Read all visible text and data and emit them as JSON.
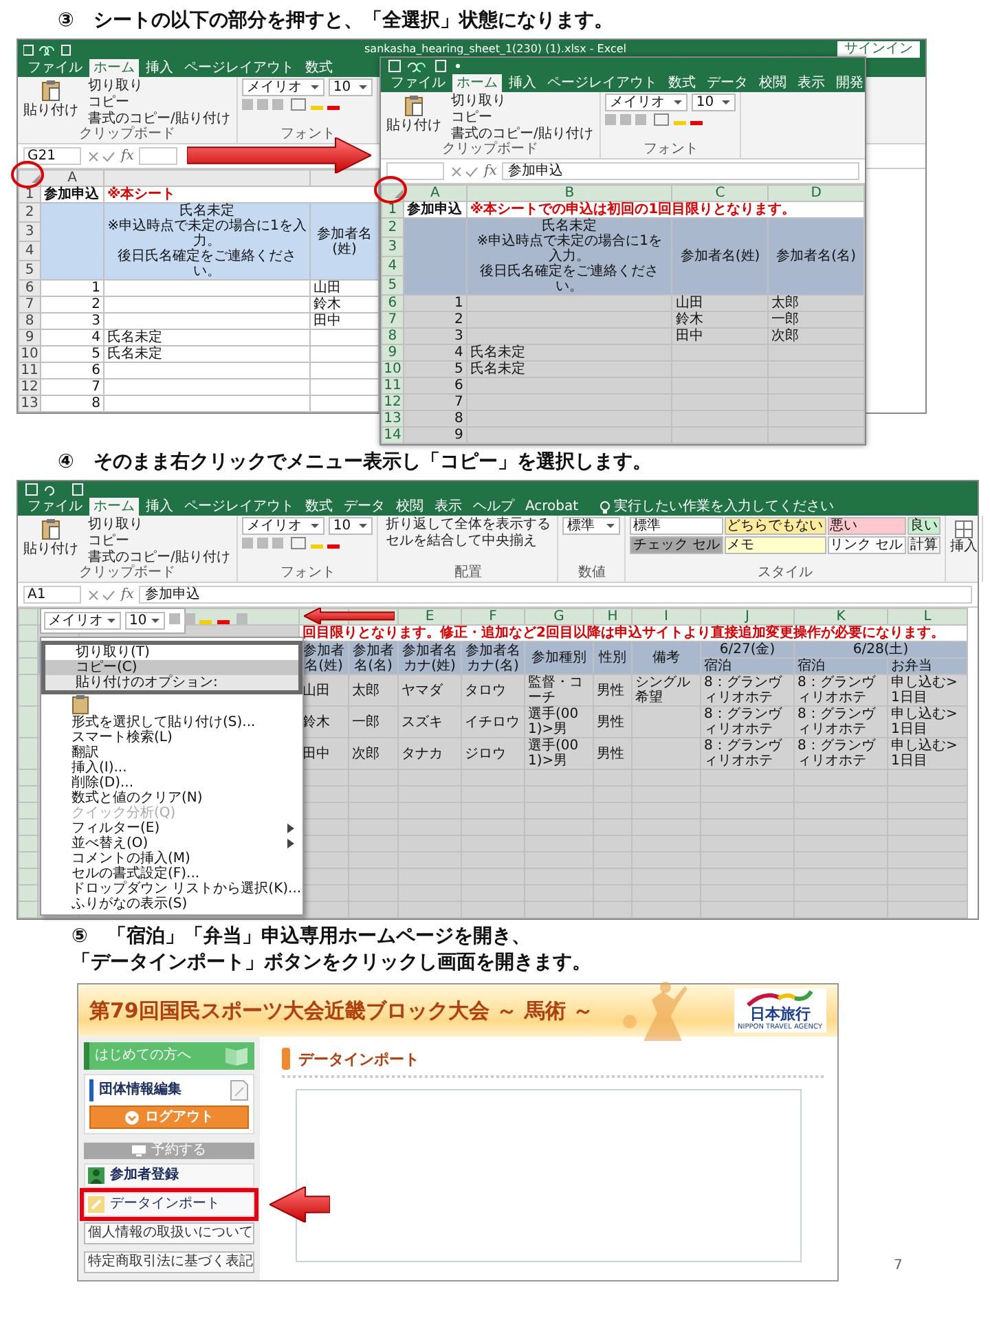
{
  "step3": {
    "heading": "③　シートの以下の部分を押すと、「全選択」状態になります。",
    "back_window": {
      "title": "sankasha_hearing_sheet_1(230) (1).xlsx - Excel",
      "sign_in": "サインイン",
      "tabs": [
        {
          "label": "ファイル",
          "selected": false
        },
        {
          "label": "ホーム",
          "selected": true
        },
        {
          "label": "挿入",
          "selected": false
        },
        {
          "label": "ページレイアウト",
          "selected": false
        },
        {
          "label": "数式",
          "selected": false
        }
      ],
      "ribbon": [
        {
          "kind": "clipboard",
          "paste": "貼り付け",
          "items": [
            "切り取り",
            "コピー",
            "書式のコピー/貼り付け"
          ],
          "label": "クリップボード"
        },
        {
          "kind": "font",
          "font": "メイリオ",
          "size": "10",
          "label": "フォント"
        }
      ],
      "name_box": "G21",
      "fx_label": "fx",
      "sheet": {
        "all_selected": false,
        "corner_circled": true,
        "columns": [
          {
            "letter": "A"
          },
          {
            "heading": [
              "氏名未定",
              "※申込時点で未定の場合に1を入力。",
              "後日氏名確定をご連絡ください。"
            ]
          },
          {
            "heading": "参加者名(姓)"
          }
        ],
        "title_row": {
          "number": "1",
          "label": "参加申込",
          "notice": "※本シート"
        },
        "header_rows": [
          "2",
          "3",
          "4",
          "5"
        ],
        "rows": [
          {
            "number": "6",
            "cells": [
              "1",
              null,
              "山田"
            ]
          },
          {
            "number": "7",
            "cells": [
              "2",
              null,
              "鈴木"
            ]
          },
          {
            "number": "8",
            "cells": [
              "3",
              null,
              "田中"
            ]
          },
          {
            "number": "9",
            "cells": [
              "4",
              "氏名未定",
              null
            ]
          },
          {
            "number": "10",
            "cells": [
              "5",
              "氏名未定",
              null
            ]
          },
          {
            "number": "11",
            "cells": [
              "6",
              null,
              null
            ]
          },
          {
            "number": "12",
            "cells": [
              "7",
              null,
              null
            ]
          },
          {
            "number": "13",
            "cells": [
              "8",
              null,
              null
            ]
          }
        ]
      }
    },
    "front_window": {
      "tabs": [
        {
          "label": "ファイル",
          "selected": false
        },
        {
          "label": "ホーム",
          "selected": true
        },
        {
          "label": "挿入",
          "selected": false
        },
        {
          "label": "ページレイアウト",
          "selected": false
        },
        {
          "label": "数式",
          "selected": false
        },
        {
          "label": "データ",
          "selected": false
        },
        {
          "label": "校閲",
          "selected": false
        },
        {
          "label": "表示",
          "selected": false
        },
        {
          "label": "開発",
          "selected": false
        }
      ],
      "ribbon": [
        {
          "kind": "clipboard",
          "paste": "貼り付け",
          "items": [
            "切り取り",
            "コピー",
            "書式のコピー/貼り付け"
          ],
          "label": "クリップボード"
        },
        {
          "kind": "font",
          "font": "メイリオ",
          "size": "10",
          "label": "フォント"
        }
      ],
      "fx_label": "fx",
      "formula": "参加申込",
      "sheet": {
        "all_selected": true,
        "corner_circled": true,
        "columns": [
          {
            "letter": "A"
          },
          {
            "letter": "B",
            "heading": [
              "氏名未定",
              "※申込時点で未定の場合に1を入力。",
              "後日氏名確定をご連絡ください。"
            ]
          },
          {
            "letter": "C",
            "heading": "参加者名(姓)"
          },
          {
            "letter": "D",
            "heading": "参加者名(名)"
          }
        ],
        "title_row": {
          "number": "1",
          "label": "参加申込",
          "notice": "※本シートでの申込は初回の1回目限りとなります。"
        },
        "header_rows": [
          "2",
          "3",
          "4",
          "5"
        ],
        "rows": [
          {
            "number": "6",
            "cells": [
              "1",
              null,
              "山田",
              "太郎"
            ]
          },
          {
            "number": "7",
            "cells": [
              "2",
              null,
              "鈴木",
              "一郎"
            ]
          },
          {
            "number": "8",
            "cells": [
              "3",
              null,
              "田中",
              "次郎"
            ]
          },
          {
            "number": "9",
            "cells": [
              "4",
              "氏名未定",
              null,
              null
            ]
          },
          {
            "number": "10",
            "cells": [
              "5",
              "氏名未定",
              null,
              null
            ]
          },
          {
            "number": "11",
            "cells": [
              "6",
              null,
              null,
              null
            ]
          },
          {
            "number": "12",
            "cells": [
              "7",
              null,
              null,
              null
            ]
          },
          {
            "number": "13",
            "cells": [
              "8",
              null,
              null,
              null
            ]
          },
          {
            "number": "14",
            "cells": [
              "9",
              null,
              null,
              null
            ]
          }
        ]
      }
    }
  },
  "step4": {
    "heading": "④　そのまま右クリックでメニュー表示し「コピー」を選択します。",
    "window": {
      "tabs": [
        {
          "label": "ファイル",
          "selected": false
        },
        {
          "label": "ホーム",
          "selected": true
        },
        {
          "label": "挿入",
          "selected": false
        },
        {
          "label": "ページレイアウト",
          "selected": false
        },
        {
          "label": "数式",
          "selected": false
        },
        {
          "label": "データ",
          "selected": false
        },
        {
          "label": "校閲",
          "selected": false
        },
        {
          "label": "表示",
          "selected": false
        },
        {
          "label": "ヘルプ",
          "selected": false
        },
        {
          "label": "Acrobat",
          "selected": false
        }
      ],
      "tell_me": "実行したい作業を入力してください",
      "ribbon": [
        {
          "kind": "clipboard",
          "paste": "貼り付け",
          "items": [
            "切り取り",
            "コピー",
            "書式のコピー/貼り付け"
          ],
          "label": "クリップボード"
        },
        {
          "kind": "font",
          "font": "メイリオ",
          "size": "10",
          "label": "フォント"
        },
        {
          "kind": "alignment",
          "items": [
            "折り返して全体を表示する",
            "セルを結合して中央揃え"
          ],
          "label": "配置"
        },
        {
          "kind": "number",
          "format": "標準",
          "label": "数値"
        },
        {
          "kind": "styles",
          "label": "スタイル",
          "cells": [
            {
              "label": "標準",
              "color": "#ffffff"
            },
            {
              "label": "どちらでもない",
              "color": "#ffeb9c"
            },
            {
              "label": "悪い",
              "color": "#ffc7ce"
            },
            {
              "label": "良い",
              "color": "#c6efce"
            },
            {
              "label": "チェック セル",
              "color": "#a5a5a5"
            },
            {
              "label": "メモ",
              "color": "#ffffcc"
            },
            {
              "label": "リンク セル",
              "color": "#ffffff"
            },
            {
              "label": "計算",
              "color": "#f2f2f2"
            }
          ]
        },
        {
          "kind": "cells",
          "button": "挿入"
        }
      ],
      "name_box": "A1",
      "fx_label": "fx",
      "formula": "参加申込",
      "mini_toolbar": {
        "font": "メイリオ",
        "size": "10"
      },
      "context_menu": [
        {
          "kind": "item",
          "label": "切り取り(T)",
          "selected": false,
          "disabled": false,
          "submenu": false,
          "framed": true
        },
        {
          "kind": "item",
          "label": "コピー(C)",
          "selected": true,
          "disabled": false,
          "submenu": false,
          "framed": true
        },
        {
          "kind": "heading",
          "label": "貼り付けのオプション:",
          "framed": true
        },
        {
          "kind": "paste_icons",
          "framed": false
        },
        {
          "kind": "item",
          "label": "形式を選択して貼り付け(S)...",
          "selected": false,
          "disabled": false,
          "submenu": false,
          "framed": false
        },
        {
          "kind": "item",
          "label": "スマート検索(L)",
          "selected": false,
          "disabled": false,
          "submenu": false,
          "framed": false
        },
        {
          "kind": "item",
          "label": "翻訳",
          "selected": false,
          "disabled": false,
          "submenu": false,
          "framed": false
        },
        {
          "kind": "item",
          "label": "挿入(I)...",
          "selected": false,
          "disabled": false,
          "submenu": false,
          "framed": false
        },
        {
          "kind": "item",
          "label": "削除(D)...",
          "selected": false,
          "disabled": false,
          "submenu": false,
          "framed": false
        },
        {
          "kind": "item",
          "label": "数式と値のクリア(N)",
          "selected": false,
          "disabled": false,
          "submenu": false,
          "framed": false
        },
        {
          "kind": "item",
          "label": "クイック分析(Q)",
          "selected": false,
          "disabled": true,
          "submenu": false,
          "framed": false
        },
        {
          "kind": "item",
          "label": "フィルター(E)",
          "selected": false,
          "disabled": false,
          "submenu": true,
          "framed": false
        },
        {
          "kind": "item",
          "label": "並べ替え(O)",
          "selected": false,
          "disabled": false,
          "submenu": true,
          "framed": false
        },
        {
          "kind": "item",
          "label": "コメントの挿入(M)",
          "selected": false,
          "disabled": false,
          "submenu": false,
          "framed": false
        },
        {
          "kind": "item",
          "label": "セルの書式設定(F)...",
          "selected": false,
          "disabled": false,
          "submenu": false,
          "framed": false
        },
        {
          "kind": "item",
          "label": "ドロップダウン リストから選択(K)...",
          "selected": false,
          "disabled": false,
          "submenu": false,
          "framed": false
        },
        {
          "kind": "item",
          "label": "ふりがなの表示(S)",
          "selected": false,
          "disabled": false,
          "submenu": false,
          "framed": false
        }
      ],
      "sheet": {
        "all_selected": true,
        "notice": "回目限りとなります。修正・追加など2回目以降は申込サイトより直接追加変更操作が必要になります。",
        "columns": [
          {
            "heading": "参加者名(姓)"
          },
          {
            "heading": "参加者名(名)"
          },
          {
            "letter": "E",
            "heading": "参加者名カナ(姓)"
          },
          {
            "letter": "F",
            "heading": "参加者名カナ(名)"
          },
          {
            "letter": "G",
            "heading": "参加種別"
          },
          {
            "letter": "H",
            "heading": "性別"
          },
          {
            "letter": "I",
            "heading": "備考"
          },
          {
            "date": "6/27(金)",
            "columns": [
              {
                "letter": "J",
                "heading": "宿泊"
              }
            ]
          },
          {
            "date": "6/28(土)",
            "columns": [
              {
                "letter": "K",
                "heading": "宿泊"
              },
              {
                "letter": "L",
                "heading": "お弁当"
              }
            ]
          }
        ],
        "rows": [
          {
            "cells": [
              "山田",
              "太郎",
              "ヤマダ",
              "タロウ",
              "監督・コーチ",
              "男性",
              "シングル希望",
              "8：グランヴィリオホテ",
              "8：グランヴィリオホテ",
              "申し込む>1日目"
            ]
          },
          {
            "cells": [
              "鈴木",
              "一郎",
              "スズキ",
              "イチロウ",
              "選手(001)>男",
              "男性",
              null,
              "8：グランヴィリオホテ",
              "8：グランヴィリオホテ",
              "申し込む>1日目"
            ]
          },
          {
            "cells": [
              "田中",
              "次郎",
              "タナカ",
              "ジロウ",
              "選手(001)>男",
              "男性",
              null,
              "8：グランヴィリオホテ",
              "8：グランヴィリオホテ",
              "申し込む>1日目"
            ]
          }
        ]
      }
    }
  },
  "step5": {
    "heading_lines": [
      "⑤　「宿泊」「弁当」申込専用ホームページを開き、",
      "「データインポート」ボタンをクリックし画面を開きます。"
    ],
    "site": {
      "title": "第79回国民スポーツ大会近畿ブロック大会 ～ 馬術 ～",
      "logo": "日本旅行",
      "logo_tagline": "NIPPON TRAVEL AGENCY",
      "sidebar": [
        {
          "kind": "guide",
          "label": "はじめての方へ",
          "highlighted": false
        },
        {
          "kind": "account",
          "label": "団体情報編集",
          "highlighted": false
        },
        {
          "kind": "logout",
          "label": "ログアウト",
          "highlighted": false
        },
        {
          "kind": "section",
          "label": "予約する",
          "highlighted": false
        },
        {
          "kind": "register",
          "label": "参加者登録",
          "highlighted": false
        },
        {
          "kind": "import",
          "label": "データインポート",
          "highlighted": true
        },
        {
          "kind": "plain",
          "label": "個人情報の取扱いについて",
          "highlighted": false
        },
        {
          "kind": "plain",
          "label": "特定商取引法に基づく表記",
          "highlighted": false
        }
      ],
      "page_title": "データインポート"
    }
  },
  "page_number": "7"
}
